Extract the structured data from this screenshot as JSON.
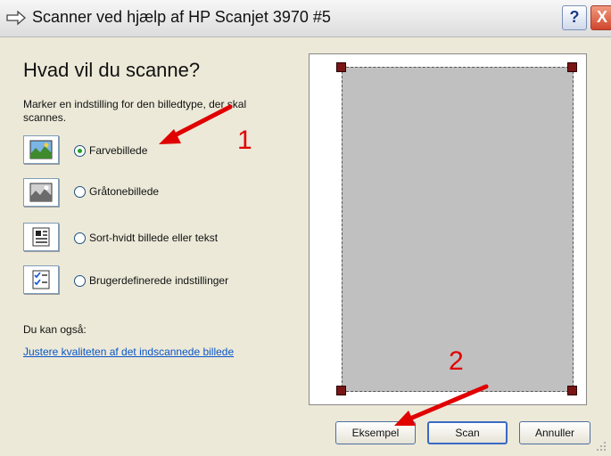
{
  "window": {
    "title": "Scanner ved hjælp af HP Scanjet 3970 #5",
    "help_label": "?",
    "close_label": "X"
  },
  "main": {
    "heading": "Hvad vil du scanne?",
    "instruction": "Marker en indstilling for den billedtype, der skal scannes."
  },
  "options": [
    {
      "label": "Farvebillede",
      "selected": true,
      "icon": "color-photo-icon"
    },
    {
      "label": "Gråtonebillede",
      "selected": false,
      "icon": "grayscale-photo-icon"
    },
    {
      "label": "Sort-hvidt billede eller tekst",
      "selected": false,
      "icon": "black-white-text-icon"
    },
    {
      "label": "Brugerdefinerede indstillinger",
      "selected": false,
      "icon": "custom-settings-icon"
    }
  ],
  "also": {
    "label": "Du kan også:",
    "link": "Justere kvaliteten af det indscannede billede"
  },
  "buttons": {
    "preview": "Eksempel",
    "scan": "Scan",
    "cancel": "Annuller"
  },
  "annotations": {
    "one": "1",
    "two": "2",
    "color": "#e00000"
  }
}
